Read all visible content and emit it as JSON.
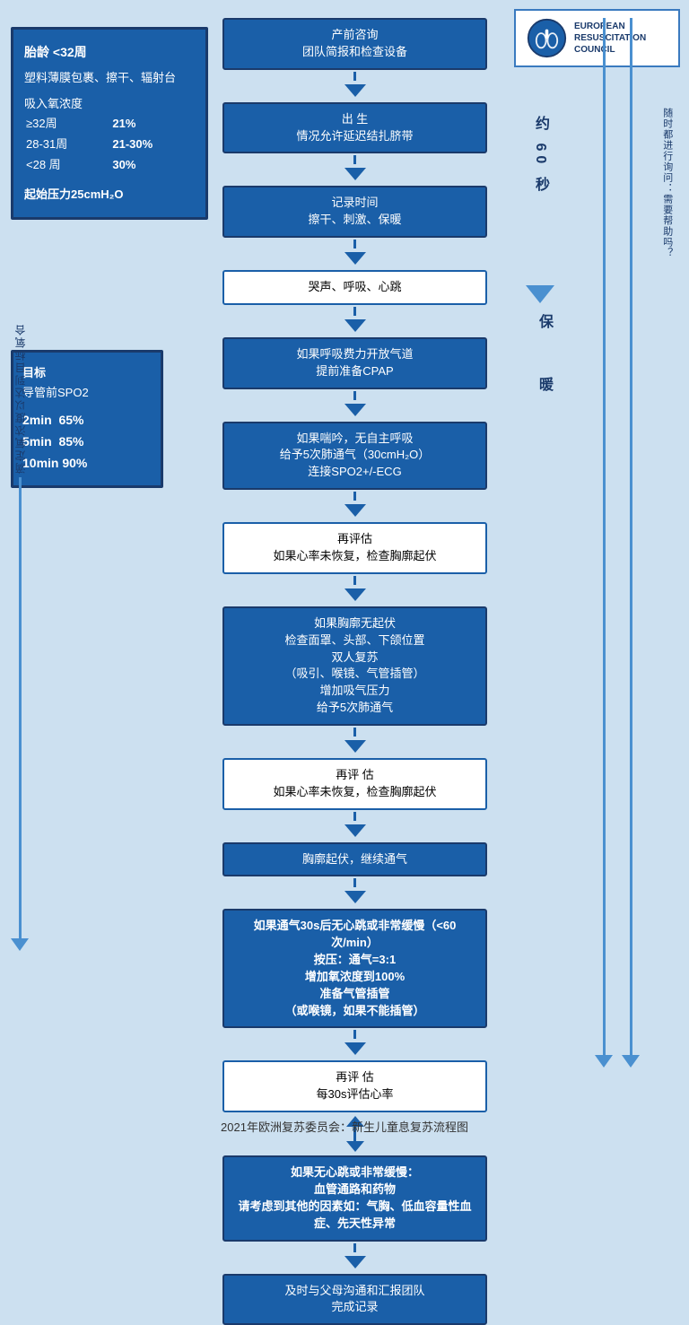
{
  "logo": {
    "org1": "EUROPEAN",
    "org2": "RESUSCITATION",
    "org3": "COUNCIL"
  },
  "leftBox1": {
    "title": "胎龄 <32周",
    "line1": "塑料薄膜包裹、擦干、辐射台",
    "line2": "吸入氧浓度",
    "tableRows": [
      [
        "≥32周",
        "21%"
      ],
      [
        "28-31周",
        "21-30%"
      ],
      [
        "<28 周",
        "30%"
      ]
    ],
    "line3": "起始压力25cmH₂O"
  },
  "leftBox2": {
    "title": "目标",
    "subtitle": "导管前SPO2",
    "rows": [
      "2min  65%",
      "5min  85%",
      "10min 90%"
    ]
  },
  "leftSideLabel": "滴定氧浓度以达到目标氧合",
  "rightLabel60": "约\n60\n秒",
  "rightLabelBao": "保",
  "rightLabelNuan": "暖",
  "farRightLabel": "随时都进行询问：需要帮助吗？",
  "flowSteps": [
    {
      "id": "step1",
      "text": "产前咨询\n团队简报和检查设备",
      "type": "blue-dark"
    },
    {
      "id": "step2",
      "text": "出 生\n情况允许延迟结扎脐带",
      "type": "blue-dark"
    },
    {
      "id": "step3",
      "text": "记录时间\n擦干、刺激、保暖",
      "type": "blue-dark"
    },
    {
      "id": "step4",
      "text": "哭声、呼吸、心跳",
      "type": "white-border"
    },
    {
      "id": "step5",
      "text": "如果呼吸费力开放气道\n提前准备CPAP",
      "type": "blue-dark"
    },
    {
      "id": "step6",
      "text": "如果喘吟，无自主呼吸\n给予5次肺通气（30cmH₂O）\n连接SPO2+/-ECG",
      "type": "blue-dark"
    },
    {
      "id": "step7",
      "text": "再评估\n如果心率未恢复，检查胸廓起伏",
      "type": "white-border"
    },
    {
      "id": "step8",
      "text": "如果胸廓无起伏\n检查面罩、头部、下颌位置\n双人复苏\n（吸引、喉镜、气管插管）\n增加吸气压力\n给予5次肺通气",
      "type": "blue-dark"
    },
    {
      "id": "step9",
      "text": "再评 估\n如果心率未恢复，检查胸廓起伏",
      "type": "white-border"
    },
    {
      "id": "step10",
      "text": "胸廓起伏，继续通气",
      "type": "blue-dark"
    },
    {
      "id": "step11",
      "text": "如果通气30s后无心跳或非常缓慢（<60次/min）\n按压：通气=3:1\n增加氧浓度到100%\n准备气管插管\n（或喉镜，如果不能插管）",
      "type": "blue-bold"
    },
    {
      "id": "step12",
      "text": "再评 估\n每30s评估心率",
      "type": "white-border"
    },
    {
      "id": "step13",
      "text": "如果无心跳或非常缓慢：\n血管通路和药物\n请考虑到其他的因素如：气胸、低血容量性血症、先天性异常",
      "type": "blue-bold"
    },
    {
      "id": "step14",
      "text": "及时与父母沟通和汇报团队\n完成记录",
      "type": "blue-dark"
    }
  ],
  "footer": "2021年欧洲复苏委员会：新生儿童息复苏流程图"
}
